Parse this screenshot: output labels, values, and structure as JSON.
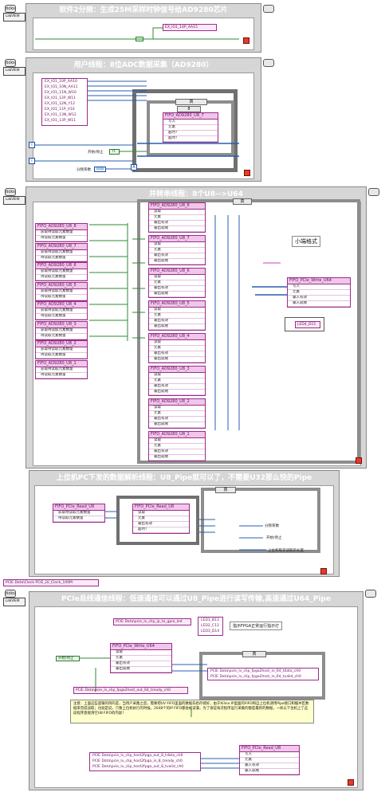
{
  "colors": {
    "loop_title": "#ffffff",
    "fifo": "#9b2d8a",
    "wire_pink": "#d93ab4",
    "wire_blue": "#2a5db0",
    "wire_green": "#2e8b2e",
    "wire_orange": "#c07a14"
  },
  "loop_tag": {
    "line1": "ticks",
    "line2": "LabVIEW"
  },
  "section1": {
    "title": "软件2分频：生成25M采样时钟信号给AD9280芯片",
    "io_label": "EX_IO1_14P_AA15"
  },
  "section2": {
    "title": "用户线程：8位ADC数据采集（AD9280）",
    "io_items": [
      "EX_IO1_10P_AA10",
      "EX_IO1_10N_AA11",
      "EX_IO1_11N_W10",
      "EX_IO1_12P_W11",
      "EX_IO1_12N_Y12",
      "EX_IO1_11P_V10",
      "EX_IO1_13N_W12",
      "EX_IO1_13P_W11"
    ],
    "fifo": {
      "name": "FIFO_AD9280_U8_7",
      "rows": [
        "写入",
        "元素",
        "超时?",
        "超时？"
      ]
    },
    "case_label": "真",
    "case_index": "8",
    "start_stop": "开始/停止",
    "start_stop_val": "TF",
    "divider_label": "分频系数",
    "divider_val": "U16",
    "iter_symbol": "i",
    "bool_symbol": "A"
  },
  "section3": {
    "title": "并转串线程：8个U8-->U64",
    "fifos_left": [
      {
        "name": "FIFO_AD9280_U8_8",
        "rows": [
          "获取待读取元素数量",
          "待读取元素数量"
        ]
      },
      {
        "name": "FIFO_AD9280_U8_7",
        "rows": [
          "获取待读取元素数量",
          "待读取元素数量"
        ]
      },
      {
        "name": "FIFO_AD9280_U8_6",
        "rows": [
          "获取待读取元素数量",
          "待读取元素数量"
        ]
      },
      {
        "name": "FIFO_AD9280_U8_5",
        "rows": [
          "获取待读取元素数量",
          "待读取元素数量"
        ]
      },
      {
        "name": "FIFO_AD9280_U8_4",
        "rows": [
          "获取待读取元素数量",
          "待读取元素数量"
        ]
      },
      {
        "name": "FIFO_AD9280_U8_3",
        "rows": [
          "获取待读取元素数量",
          "待读取元素数量"
        ]
      },
      {
        "name": "FIFO_AD9280_U8_2",
        "rows": [
          "获取待读取元素数量",
          "待读取元素数量"
        ]
      },
      {
        "name": "FIFO_AD9280_U8_1",
        "rows": [
          "获取待读取元素数量",
          "待读取元素数量"
        ]
      }
    ],
    "fifos_right": [
      {
        "name": "FIFO_AD9280_U8_8",
        "rows": [
          "读取",
          "元素",
          "输出有效",
          "输出就绪"
        ]
      },
      {
        "name": "FIFO_AD9280_U8_7",
        "rows": [
          "读取",
          "元素",
          "输出有效",
          "输出就绪"
        ]
      },
      {
        "name": "FIFO_AD9280_U8_6",
        "rows": [
          "读取",
          "元素",
          "输出有效",
          "输出就绪"
        ]
      },
      {
        "name": "FIFO_AD9280_U8_5",
        "rows": [
          "读取",
          "元素",
          "输出有效",
          "输出就绪"
        ]
      },
      {
        "name": "FIFO_AD9280_U8_4",
        "rows": [
          "读取",
          "元素",
          "输出有效",
          "输出就绪"
        ]
      },
      {
        "name": "FIFO_AD9280_U8_3",
        "rows": [
          "读取",
          "元素",
          "输出有效",
          "输出就绪"
        ]
      },
      {
        "name": "FIFO_AD9280_U8_2",
        "rows": [
          "读取",
          "元素",
          "输出有效",
          "输出就绪"
        ]
      },
      {
        "name": "FIFO_AD9280_U8_1",
        "rows": [
          "读取",
          "元素",
          "输出有效",
          "输出就绪"
        ]
      }
    ],
    "case_label": "真",
    "little_endian": "小端格式",
    "write_fifo": {
      "name": "FIFO_PCIe_Write_U64",
      "rows": [
        "写入",
        "元素",
        "输入有效",
        "输入就绪"
      ]
    },
    "led": "LED4_D15"
  },
  "section4": {
    "title": "上位机PC下发的数据解析线程：U8_Pipe就可以了，不需要U32那么快的Pipe",
    "read_fifo": {
      "name": "FIFO_PCIe_Read_U8",
      "rows": [
        "获取待读取元素数量",
        "待读取元素数量"
      ]
    },
    "read_fifo2": {
      "name": "FIFO_PCIe_Read_U8",
      "rows": [
        "读取",
        "元素",
        "输出有效",
        "超时？"
      ]
    },
    "case_label": "真",
    "divider_out": "分频系数",
    "start_stop": "开始/停止",
    "length_label": "上位机每次读取的长度"
  },
  "clock_ref": "PCIE Data\\Clock PCIE_LV_Clock_100M",
  "section5": {
    "title": "PCIe总线通信线程：低速通信可以通过U8_Pipe进行读写传输,高速通过U64_Pipe",
    "gpio_ref": "PCIE Data\\pcie_lv_clip_ip_to_gpio_led",
    "leds": [
      "LED1_B13",
      "LED2_C13",
      "LED3_D14"
    ],
    "led_comment": "指示FPGA正常运行指示灯",
    "start_stop": "开始/停止",
    "write_fifo": {
      "name": "FIFO_PCIe_Write_U64",
      "rows": [
        "读取",
        "元素",
        "输出有效",
        "输出就绪"
      ]
    },
    "case_label": "真",
    "case_items": [
      "PCIE Data\\pcie_lv_clip_fpga2host_in_64_tdata_ch0",
      "PCIE Data\\pcie_lv_clip_fpga2host_in_64_tvalid_ch0"
    ],
    "tready_ref": "PCIE Data\\pcie_lv_clip_fpga2host_out_64_tready_ch0",
    "note": "注意：上面这些逻辑的目的是，当用户采集之后，需要把UV FIFO里面的数据先给存储好，由于Xilinx IP里面的FIFO和自上位机调用Pipe接口和缓冲区数据来完成读取；也就是说，只要上位机执行的时候，2048个的IP FIFO都会被读满，为了保证每次程序运行采集的都是最新的数据，一样以下位机上了这段程序直接清空U8 FIFO的内容！",
    "host_refs": [
      "PCIE Data\\pcie_lv_clip_host2fpga_out_8_tdata_ch0",
      "PCIE Data\\pcie_lv_clip_host2fpga_in_8_tready_ch0",
      "PCIE Data\\pcie_lv_clip_host2fpga_out_8_tvalid_ch0"
    ],
    "read_fifo": {
      "name": "FIFO_PCIe_Read_U8",
      "rows": [
        "写入",
        "元素",
        "输入有效",
        "输入就绪"
      ]
    }
  }
}
